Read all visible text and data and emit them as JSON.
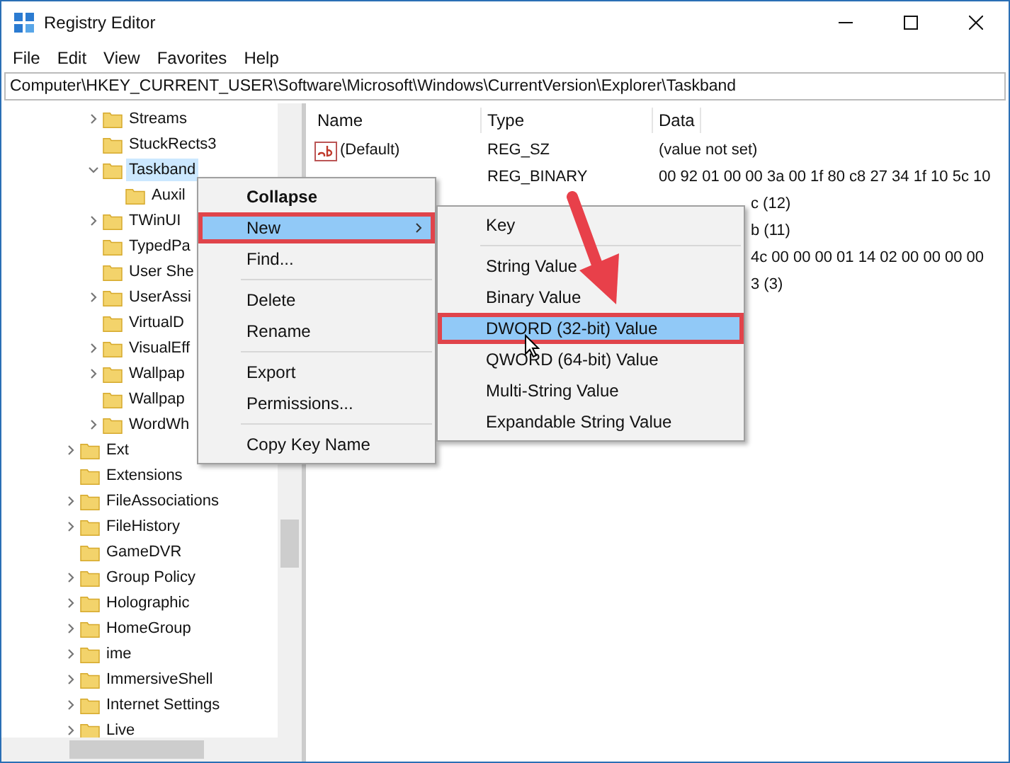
{
  "window": {
    "title": "Registry Editor"
  },
  "menu_bar": [
    "File",
    "Edit",
    "View",
    "Favorites",
    "Help"
  ],
  "address": "Computer\\HKEY_CURRENT_USER\\Software\\Microsoft\\Windows\\CurrentVersion\\Explorer\\Taskband",
  "tree": [
    {
      "children": [
        {
          "label": "Streams",
          "expanded": false,
          "selected": false
        },
        {
          "label": "StuckRects3",
          "selected": false
        },
        {
          "label": "Taskband",
          "expanded": true,
          "selected": true,
          "children": [
            {
              "label": "Auxil",
              "selected": false
            }
          ]
        },
        {
          "label": "TWinUI",
          "expanded": false,
          "selected": false
        },
        {
          "label": "TypedPa",
          "selected": false
        },
        {
          "label": "User She",
          "selected": false
        },
        {
          "label": "UserAssi",
          "expanded": false,
          "selected": false
        },
        {
          "label": "VirtualD",
          "selected": false
        },
        {
          "label": "VisualEff",
          "expanded": false,
          "selected": false
        },
        {
          "label": "Wallpap",
          "expanded": false,
          "selected": false
        },
        {
          "label": "Wallpap",
          "selected": false
        },
        {
          "label": "WordWh",
          "expanded": false,
          "selected": false
        }
      ]
    },
    {
      "label": "Ext",
      "expanded": false,
      "selected": false
    },
    {
      "label": "Extensions",
      "selected": false
    },
    {
      "label": "FileAssociations",
      "expanded": false,
      "selected": false
    },
    {
      "label": "FileHistory",
      "expanded": false,
      "selected": false
    },
    {
      "label": "GameDVR",
      "selected": false
    },
    {
      "label": "Group Policy",
      "expanded": false,
      "selected": false
    },
    {
      "label": "Holographic",
      "expanded": false,
      "selected": false
    },
    {
      "label": "HomeGroup",
      "expanded": false,
      "selected": false
    },
    {
      "label": "ime",
      "expanded": false,
      "selected": false
    },
    {
      "label": "ImmersiveShell",
      "expanded": false,
      "selected": false
    },
    {
      "label": "Internet Settings",
      "expanded": false,
      "selected": false
    },
    {
      "label": "Live",
      "expanded": false,
      "selected": false
    }
  ],
  "values": {
    "columns": [
      "Name",
      "Type",
      "Data"
    ],
    "rows": [
      {
        "kind": "full",
        "name": "(Default)",
        "type": "REG_SZ",
        "data": "(value not set)"
      },
      {
        "kind": "covered",
        "type": "REG_BINARY",
        "data": "00 92 01 00 00 3a 00 1f 80 c8 27 34 1f 10 5c 10"
      },
      {
        "kind": "partial",
        "data": "c (12)"
      },
      {
        "kind": "partial",
        "data": "b (11)"
      },
      {
        "kind": "partial",
        "data": "4c 00 00 00 01 14 02 00 00 00 00"
      },
      {
        "kind": "partial",
        "data": "3 (3)"
      }
    ]
  },
  "context_menu": [
    {
      "kind": "item",
      "label": "Collapse",
      "bold": true,
      "selected": false,
      "marked": false,
      "submenu": false
    },
    {
      "kind": "item",
      "label": "New",
      "bold": false,
      "selected": true,
      "marked": true,
      "submenu": true
    },
    {
      "kind": "item",
      "label": "Find...",
      "bold": false,
      "selected": false,
      "marked": false,
      "submenu": false
    },
    {
      "kind": "separator"
    },
    {
      "kind": "item",
      "label": "Delete",
      "bold": false,
      "selected": false,
      "marked": false,
      "submenu": false
    },
    {
      "kind": "item",
      "label": "Rename",
      "bold": false,
      "selected": false,
      "marked": false,
      "submenu": false
    },
    {
      "kind": "separator"
    },
    {
      "kind": "item",
      "label": "Export",
      "bold": false,
      "selected": false,
      "marked": false,
      "submenu": false
    },
    {
      "kind": "item",
      "label": "Permissions...",
      "bold": false,
      "selected": false,
      "marked": false,
      "submenu": false
    },
    {
      "kind": "separator"
    },
    {
      "kind": "item",
      "label": "Copy Key Name",
      "bold": false,
      "selected": false,
      "marked": false,
      "submenu": false
    }
  ],
  "submenu": [
    {
      "kind": "item",
      "label": "Key",
      "selected": false,
      "marked": false
    },
    {
      "kind": "separator"
    },
    {
      "kind": "item",
      "label": "String Value",
      "selected": false,
      "marked": false
    },
    {
      "kind": "item",
      "label": "Binary Value",
      "selected": false,
      "marked": false
    },
    {
      "kind": "item",
      "label": "DWORD (32-bit) Value",
      "selected": true,
      "marked": true
    },
    {
      "kind": "item",
      "label": "QWORD (64-bit) Value",
      "selected": false,
      "marked": false
    },
    {
      "kind": "item",
      "label": "Multi-String Value",
      "selected": false,
      "marked": false
    },
    {
      "kind": "item",
      "label": "Expandable String Value",
      "selected": false,
      "marked": false
    }
  ]
}
